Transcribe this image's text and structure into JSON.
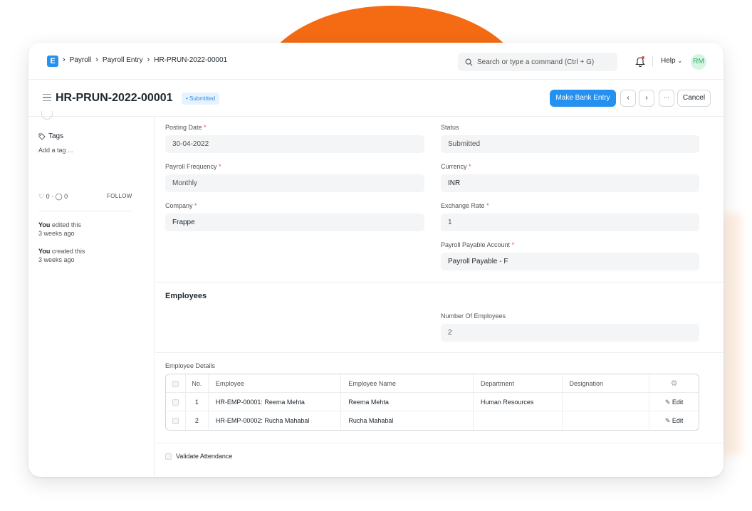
{
  "colors": {
    "accent": "#2490ef",
    "brand_blob": "#f56b14",
    "avatar_bg": "#d5f5e0",
    "avatar_fg": "#30a66d",
    "required": "#e24c4c"
  },
  "navbar": {
    "logo_letter": "E",
    "breadcrumbs": [
      "Payroll",
      "Payroll Entry",
      "HR-PRUN-2022-00001"
    ],
    "search_placeholder": "Search or type a command (Ctrl + G)",
    "help_label": "Help",
    "avatar_initials": "RM",
    "icons": [
      "search-icon",
      "bell-icon",
      "chevron-down-icon"
    ]
  },
  "header": {
    "title": "HR-PRUN-2022-00001",
    "status_badge": "• Submitted",
    "primary_action": "Make Bank Entry",
    "prev_label": "‹",
    "next_label": "›",
    "more_label": "···",
    "cancel_label": "Cancel"
  },
  "sidebar": {
    "tags_label": "Tags",
    "add_tag": "Add a tag ...",
    "likes": "♡ 0 · ◯ 0",
    "follow": "FOLLOW",
    "activity": [
      {
        "who": "You",
        "what": " edited this",
        "when": "3 weeks ago"
      },
      {
        "who": "You",
        "what": " created this",
        "when": "3 weeks ago"
      }
    ]
  },
  "form": {
    "posting_date": {
      "label": "Posting Date",
      "req": "*",
      "value": "30-04-2022"
    },
    "status": {
      "label": "Status",
      "value": "Submitted"
    },
    "payroll_frequency": {
      "label": "Payroll Frequency",
      "req": "*",
      "value": "Monthly"
    },
    "currency": {
      "label": "Currency",
      "req": "*",
      "value": "INR"
    },
    "company": {
      "label": "Company",
      "req": "*",
      "value": "Frappe"
    },
    "exchange_rate": {
      "label": "Exchange Rate",
      "req": "*",
      "value": "1"
    },
    "payable_account": {
      "label": "Payroll Payable Account",
      "req": "*",
      "value": "Payroll Payable - F"
    },
    "employees_section": "Employees",
    "number_of_employees": {
      "label": "Number Of Employees",
      "value": "2"
    },
    "employee_details_label": "Employee Details",
    "validate_attendance": "Validate Attendance"
  },
  "table": {
    "headers": [
      "No.",
      "Employee",
      "Employee Name",
      "Department",
      "Designation"
    ],
    "edit_label": "Edit",
    "rows": [
      {
        "no": "1",
        "employee": "HR-EMP-00001: Reema Mehta",
        "name": "Reema Mehta",
        "department": "Human Resources",
        "designation": ""
      },
      {
        "no": "2",
        "employee": "HR-EMP-00002: Rucha Mahabal",
        "name": "Rucha Mahabal",
        "department": "",
        "designation": ""
      }
    ]
  }
}
